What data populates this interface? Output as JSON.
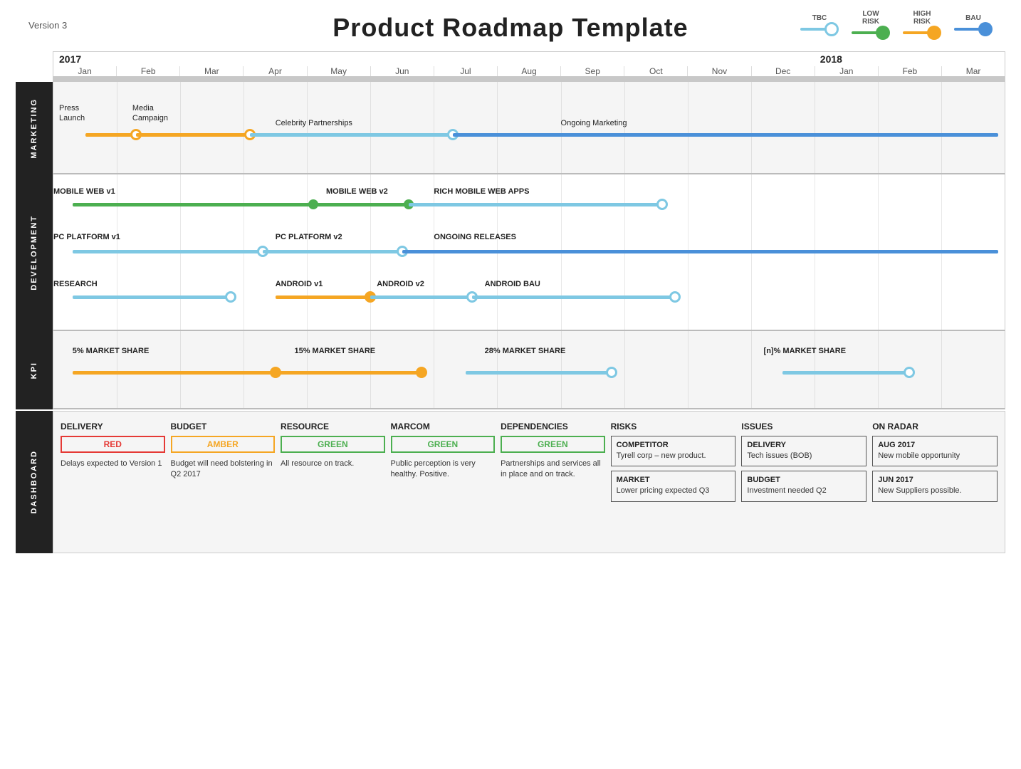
{
  "header": {
    "version": "Version 3",
    "title": "Product Roadmap Template"
  },
  "legend": {
    "items": [
      {
        "label": "TBC",
        "color": "#7ec8e3",
        "type": "dot-outline"
      },
      {
        "label": "LOW\nRISK",
        "color": "#4caf50",
        "type": "dot-filled"
      },
      {
        "label": "HIGH\nRISK",
        "color": "#f5a623",
        "type": "dot-filled"
      },
      {
        "label": "BAU",
        "color": "#4a90d9",
        "type": "dot-filled"
      }
    ]
  },
  "timeline": {
    "years": [
      "2017",
      "2018"
    ],
    "months": [
      "Jan",
      "Feb",
      "Mar",
      "Apr",
      "May",
      "Jun",
      "Jul",
      "Aug",
      "Sep",
      "Oct",
      "Nov",
      "Dec",
      "Jan",
      "Feb",
      "Mar"
    ]
  },
  "marketing": {
    "label": "MARKETING",
    "bars": [
      {
        "label": "Press\nLaunch",
        "start": 0,
        "end": 1,
        "color": "#f5a623",
        "dot_end": 1
      },
      {
        "label": "Media\nCampaign",
        "start": 1,
        "end": 3,
        "color": "#f5a623",
        "dot_end": 3
      },
      {
        "label": "Celebrity Partnerships",
        "start": 3,
        "end": 6,
        "color": "#7ec8e3",
        "dot_end": 6
      },
      {
        "label": "Ongoing Marketing",
        "start": 6,
        "end": 14,
        "color": "#4a90d9",
        "dot_end": 6
      }
    ]
  },
  "development": {
    "label": "DEVELOPMENT",
    "rows": [
      {
        "label": "MOBILE WEB v1",
        "start": 0,
        "end": 4,
        "color": "#4caf50",
        "dot_end": 4,
        "continuation_label": "MOBILE WEB v2",
        "cont_start": 4,
        "cont_end": 5.5,
        "cont_color": "#4caf50",
        "cont_dot": 5.5,
        "cont2_label": "RICH MOBILE WEB APPS",
        "cont2_start": 5.5,
        "cont2_end": 9.5,
        "cont2_color": "#7ec8e3",
        "cont2_dot": 9.5
      },
      {
        "label": "PC PLATFORM v1",
        "start": 0,
        "end": 3.2,
        "color": "#7ec8e3",
        "dot_end": 3.2,
        "continuation_label": "PC PLATFORM v2",
        "cont_start": 3.2,
        "cont_end": 5.5,
        "cont_color": "#7ec8e3",
        "cont_dot": 5.5,
        "cont2_label": "ONGOING RELEASES",
        "cont2_start": 5.5,
        "cont2_end": 14,
        "cont2_color": "#4a90d9"
      },
      {
        "label": "RESEARCH",
        "start": 0,
        "end": 2.8,
        "color": "#7ec8e3",
        "dot_end": 2.8,
        "continuation_label": "ANDROID v1",
        "cont_start": 3.5,
        "cont_end": 5,
        "cont_color": "#f5a623",
        "cont_dot": 5,
        "cont2_label": "ANDROID v2",
        "cont2_start": 5,
        "cont2_end": 6.5,
        "cont2_color": "#7ec8e3",
        "cont2_dot": 6.5,
        "cont3_label": "ANDROID BAU",
        "cont3_start": 6.5,
        "cont3_end": 9.5,
        "cont3_color": "#7ec8e3",
        "cont3_dot": 9.5
      }
    ]
  },
  "kpi": {
    "label": "KPI",
    "items": [
      {
        "label": "5% MARKET SHARE",
        "start": 0,
        "end": 3.5,
        "color": "#f5a623",
        "dot": 3.5
      },
      {
        "label": "15% MARKET SHARE",
        "start": 3.5,
        "end": 5.8,
        "color": "#f5a623",
        "dot": 5.8
      },
      {
        "label": "28% MARKET SHARE",
        "start": 6.5,
        "end": 8.8,
        "color": "#7ec8e3",
        "dot": 8.8
      },
      {
        "label": "[n]% MARKET SHARE",
        "start": 11.5,
        "end": 13.5,
        "color": "#7ec8e3",
        "dot": 13.5
      }
    ]
  },
  "dashboard": {
    "label": "DASHBOARD",
    "columns": [
      {
        "title": "DELIVERY",
        "badge": "RED",
        "badge_color": "#e53935",
        "text": "Delays expected to Version 1"
      },
      {
        "title": "BUDGET",
        "badge": "AMBER",
        "badge_color": "#f5a623",
        "text": "Budget will need bolstering in Q2 2017"
      },
      {
        "title": "RESOURCE",
        "badge": "GREEN",
        "badge_color": "#4caf50",
        "text": "All resource on track."
      },
      {
        "title": "MARCOM",
        "badge": "GREEN",
        "badge_color": "#4caf50",
        "text": "Public perception is very healthy. Positive."
      },
      {
        "title": "DEPENDENCIES",
        "badge": "GREEN",
        "badge_color": "#4caf50",
        "text": "Partnerships and services all in place and on track."
      },
      {
        "title": "RISKS",
        "boxes": [
          {
            "title": "COMPETITOR",
            "text": "Tyrell corp – new product."
          },
          {
            "title": "MARKET",
            "text": "Lower pricing expected Q3"
          }
        ]
      },
      {
        "title": "ISSUES",
        "boxes": [
          {
            "title": "DELIVERY",
            "text": "Tech issues (BOB)"
          },
          {
            "title": "BUDGET",
            "text": "Investment needed Q2"
          }
        ]
      },
      {
        "title": "ON RADAR",
        "items": [
          {
            "date": "AUG 2017",
            "text": "New mobile opportunity"
          },
          {
            "date": "JUN 2017",
            "text": "New Suppliers possible."
          }
        ]
      }
    ]
  }
}
